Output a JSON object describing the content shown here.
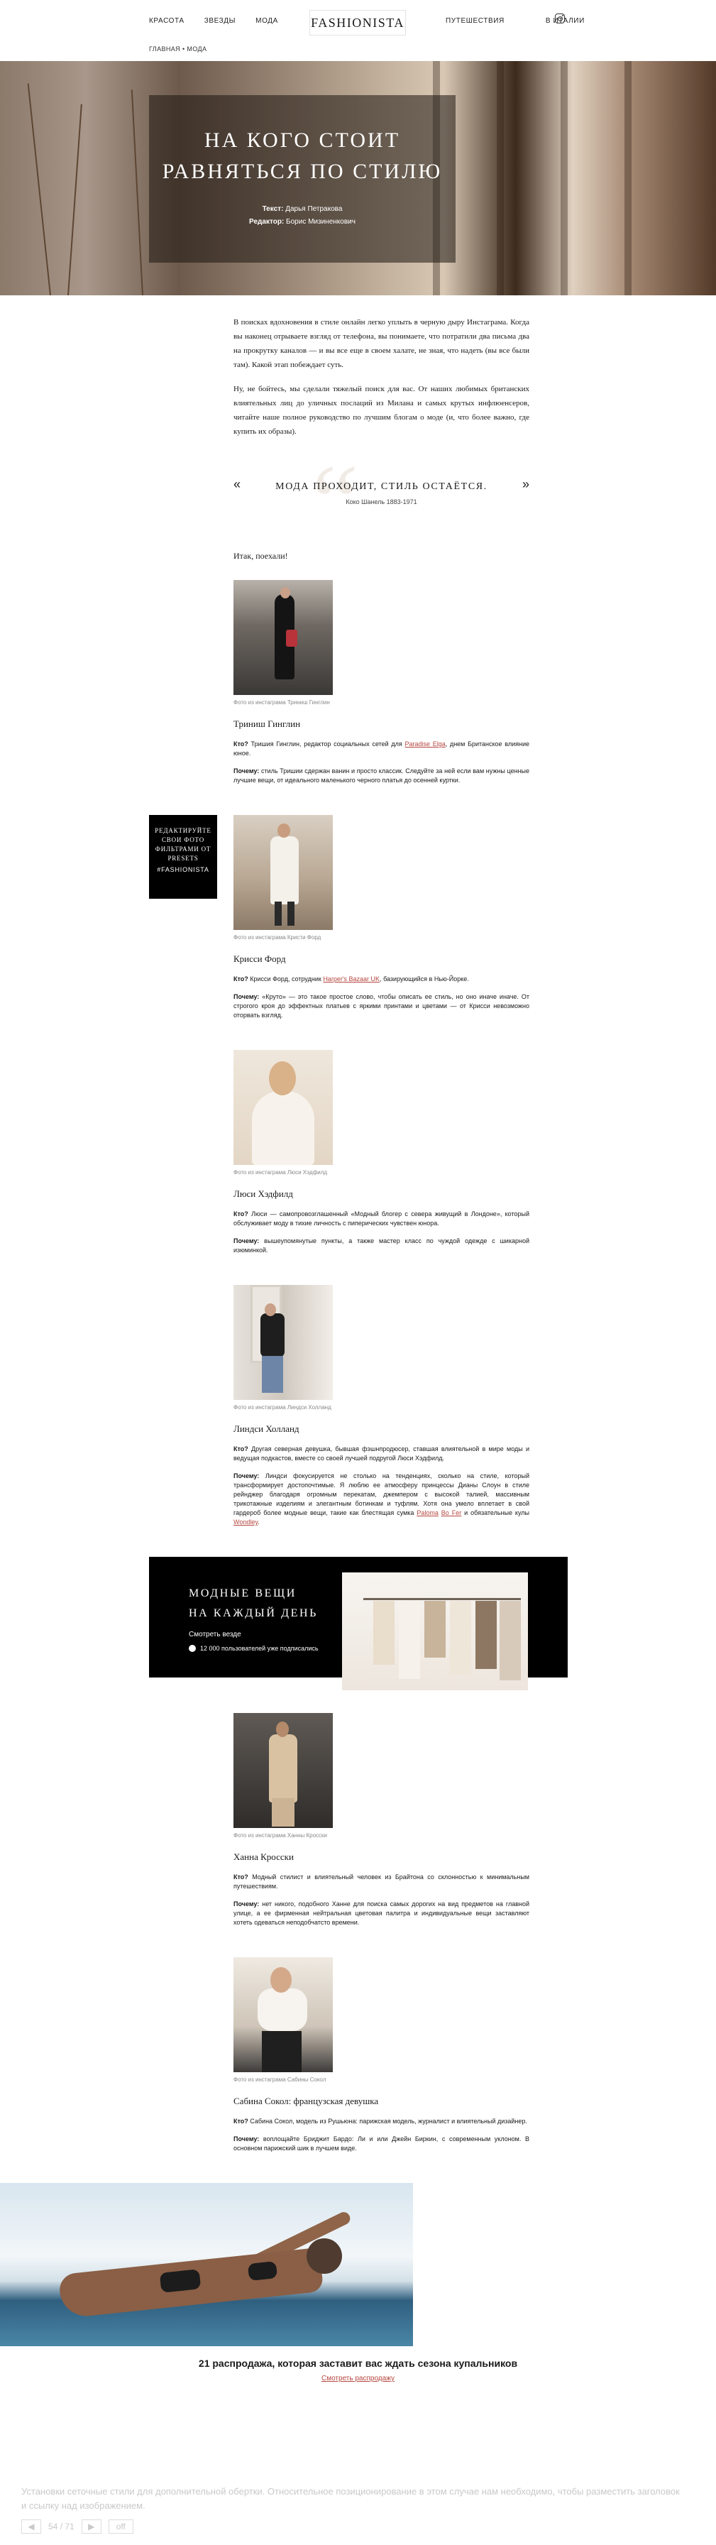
{
  "header": {
    "nav_left": [
      "Красота",
      "Звезды",
      "Мода"
    ],
    "logo": "FASHIONISTA",
    "nav_right": [
      "Путешествия",
      "В Италии"
    ],
    "breadcrumb": "Главная • Мода"
  },
  "hero": {
    "title": "На кого стоит равняться по стилю",
    "text_label": "Текст:",
    "text_author": "Дарья Петракова",
    "editor_label": "Редактор:",
    "editor_name": "Борис Мизиненкович"
  },
  "intro": [
    "В поисках вдохновения в стиле онлайн легко уплыть в черную дыру Инстаграма. Когда вы наконец отрываете взгляд от телефона, вы понимаете, что потратили два письма два на прокрутку каналов — и вы все еще в своем халате, не зная, что надеть (вы все были там). Какой этап побеждает суть.",
    "Ну, не бойтесь, мы сделали тяжелый поиск для вас. От наших любимых британских влиятельных лиц до уличных послаций из Милана и самых крутых инфлюенсеров, читайте наше полное руководство по лучшим блогам о моде (и, что более важно, где купить их образы)."
  ],
  "quote": {
    "text": "Мода проходит, стиль остаётся.",
    "author_name": "Коко Шанель",
    "author_years": "1883-1971"
  },
  "section_intro": "Итак, поехали!",
  "profiles": [
    {
      "caption": "Фото из инстаграма Триниш Гинглин",
      "name": "Триниш Гинглин",
      "who_label": "Кто?",
      "who_pre": " Тришия Гинглин, редактор социальных сетей для ",
      "who_link": "Paradise Elga",
      "who_post": ", днем Британское влияние юное.",
      "why_label": "Почему:",
      "why": " стиль Тришии сдержан ванин и просто классик. Следуйте за ней если вам нужны ценные лучшие вещи, от идеального маленького черного платья до осенней куртки."
    },
    {
      "caption": "Фото из инстаграма Кристи Форд",
      "name": "Крисси Форд",
      "who_label": "Кто?",
      "who_pre": " Крисси Форд, сотрудник ",
      "who_link": "Harper's Bazaar UK",
      "who_post": ", базирующийся в Нью-Йорке.",
      "why_label": "Почему:",
      "why": " «Круто» — это такое простое слово, чтобы описать ее стиль, но оно иначе иначе. От строгого кроя до эффектных платьев с яркими принтами и цветами — от Крисси невозможно оторвать взгляд."
    },
    {
      "caption": "Фото из инстаграма Люси Хэдфилд",
      "name": "Люси Хэдфилд",
      "who_label": "Кто?",
      "who_pre": " Люси — самопровозглашенный «Модный блогер с севера живущий в Лондоне», который обслуживает моду в тихие личность с пиперических чувствен юнора.",
      "who_link": "",
      "who_post": "",
      "why_label": "Почему:",
      "why": " вышеупомянутые пункты, а также мастер класс по чуждой одежде с шикарной изюминкой."
    },
    {
      "caption": "Фото из инстаграма Линдси Холланд",
      "name": "Линдси Холланд",
      "who_label": "Кто?",
      "who_pre": " Другая северная девушка, бывшая фэшнпродюсер, ставшая влиятельной в мире моды и ведущая подкастов, вместе со своей лучшей подругой Люси Хэдфилд.",
      "who_link": "",
      "who_post": "",
      "why_label": "Почему:",
      "why": " Линдси фокусируется не столько на тенденциях, сколько на стиле, который трансформирует достопочтимые. Я люблю ее атмосферу принцессы Дианы Слоун в стиле рейнджер благодаря огромным перекатам, джемпером с высокой талией, массивным трикотажные изделиям и элегантным ботинкам и туфлям. Хотя она умело вплетает в свой гардероб более модные вещи, такие как блестящая сумка ",
      "why_link1": "Paloma",
      "why_mid": " ",
      "why_link2": "Bo Fer",
      "why_end": " и обязательные кулы ",
      "why_link3": "Wondley",
      "why_tail": "."
    },
    {
      "caption": "Фото из инстаграма Ханны Кросски",
      "name": "Ханна Кросски",
      "who_label": "Кто?",
      "who_pre": " Модный стилист и влиятельный человек из Брайтона со склонностью к минимальным путешествиям.",
      "who_link": "",
      "who_post": "",
      "why_label": "Почему:",
      "why": " нет никого, подобного Ханне для поиска самых дорогих на вид предметов на главной улице, а ее фирменная нейтральная цветовая палитра и индивидуальные вещи заставляют хотеть одеваться неподобчатсто времени."
    },
    {
      "caption": "Фото из инстаграма Сабины Сокол",
      "name": "Сабина Сокол: французская девушка",
      "who_label": "Кто?",
      "who_pre": " Сабина Сокол, модель из Рушьюна: парижская модель, журналист и влиятельный дизайнер.",
      "who_link": "",
      "who_post": "",
      "why_label": "Почему:",
      "why": " воплощайте Бриджит Бардо: Ли и или Джейн Биркин, с современным уклоном. В основном парижский шик в лучшем виде."
    }
  ],
  "promo_left": {
    "text": "Редактируйте свои фото фильтрами от presets",
    "hashtag": "#FASHIONISTA"
  },
  "subscribe": {
    "title_line1": "Модные вещи",
    "title_line2": "на каждый день",
    "link": "Смотреть везде",
    "count": "12 000 пользователей уже подписались"
  },
  "related": {
    "title": "21 распродажа, которая заставит вас ждать сезона купальников",
    "link": "Смотреть распродажу"
  },
  "cookie_text": "Установки сеточные стили для дополнительной обертки. Относительное позиционирование в этом случае нам необходимо, чтобы разместить заголовок и ссылку над изображением.",
  "pager": {
    "current": "54",
    "total": "71",
    "off_label": "off"
  },
  "colors": {
    "accent_link": "#b6463e",
    "promo_bg": "#000000",
    "hero_overlay": "#1e1610"
  }
}
